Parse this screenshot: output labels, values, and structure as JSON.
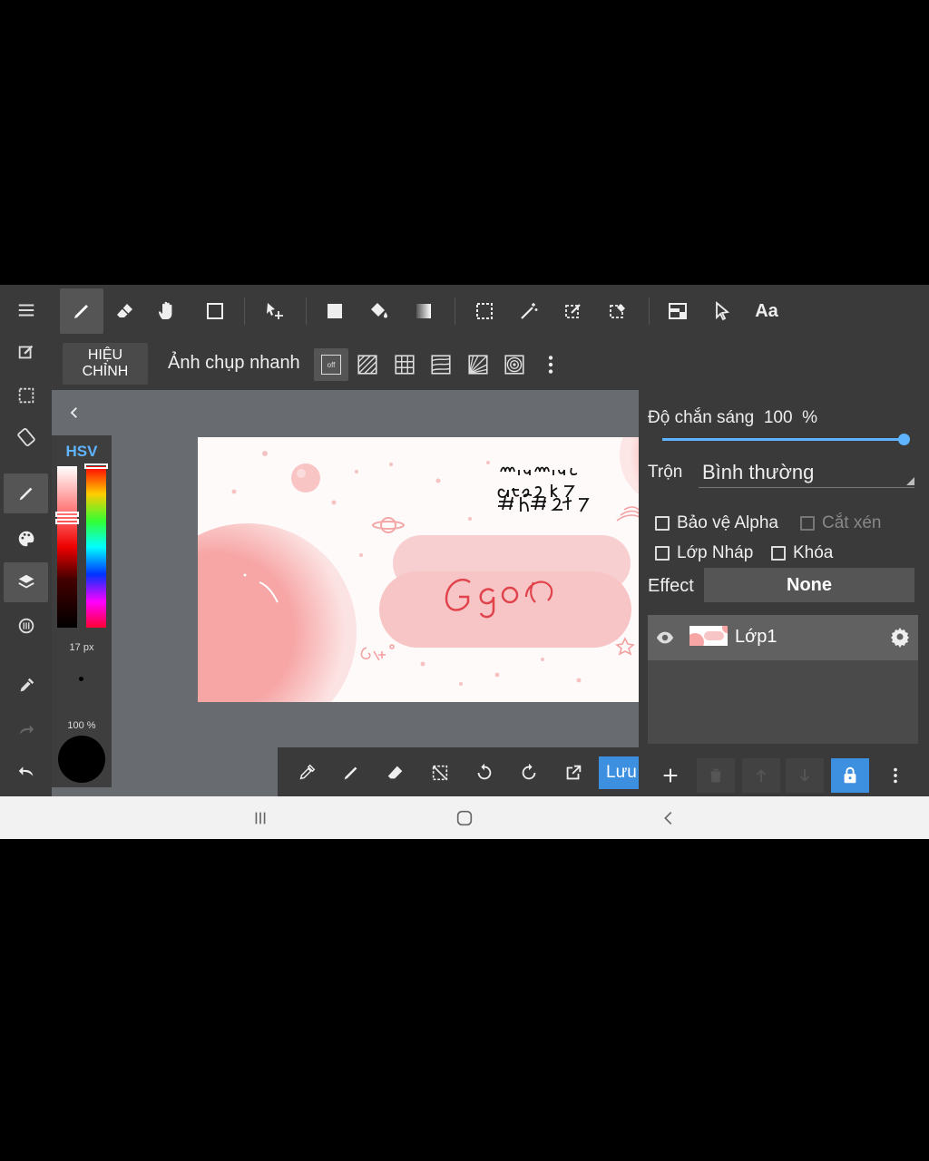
{
  "top_toolbar": {
    "tools": [
      "pen-icon",
      "eraser-icon",
      "hand-icon",
      "rectangle-icon",
      "move-icon",
      "fill-rect-icon",
      "bucket-icon",
      "gradient-icon",
      "select-rect-icon",
      "magic-wand-icon",
      "select-pen-icon",
      "select-eraser-icon",
      "frame-icon",
      "cursor-icon"
    ],
    "text_tool_label": "Aa"
  },
  "sub_toolbar": {
    "adjust_line1": "HIỆU",
    "adjust_line2": "CHỈNH",
    "snap_label": "Ảnh chụp nhanh",
    "snap_off": "off"
  },
  "color_panel": {
    "mode": "HSV",
    "brush_size": "17 px",
    "opacity": "100 %",
    "current_color": "#000000"
  },
  "artwork": {
    "handwriting_line1": "miumiu",
    "handwriting_line2": "arte2 k7",
    "handwriting_line3": "#h#247",
    "center_text": "Ggo"
  },
  "canvas_tools": {
    "save_label": "Lưu"
  },
  "layer_panel": {
    "opacity_label": "Độ chắn sáng",
    "opacity_value": "100",
    "opacity_unit": "%",
    "opacity_level": 1.0,
    "blend_label": "Trộn",
    "blend_value": "Bình thường",
    "protect_alpha": "Bảo vệ Alpha",
    "clipping": "Cắt xén",
    "draft_layer": "Lớp Nháp",
    "lock": "Khóa",
    "effect_label": "Effect",
    "effect_value": "None",
    "layers": [
      {
        "name": "Lớp1",
        "visible": true
      }
    ]
  },
  "colors": {
    "accent": "#3d8fe0",
    "panel": "#3a3a3a",
    "canvas_bg": "#686b70",
    "pink": "#f6a3a3"
  }
}
